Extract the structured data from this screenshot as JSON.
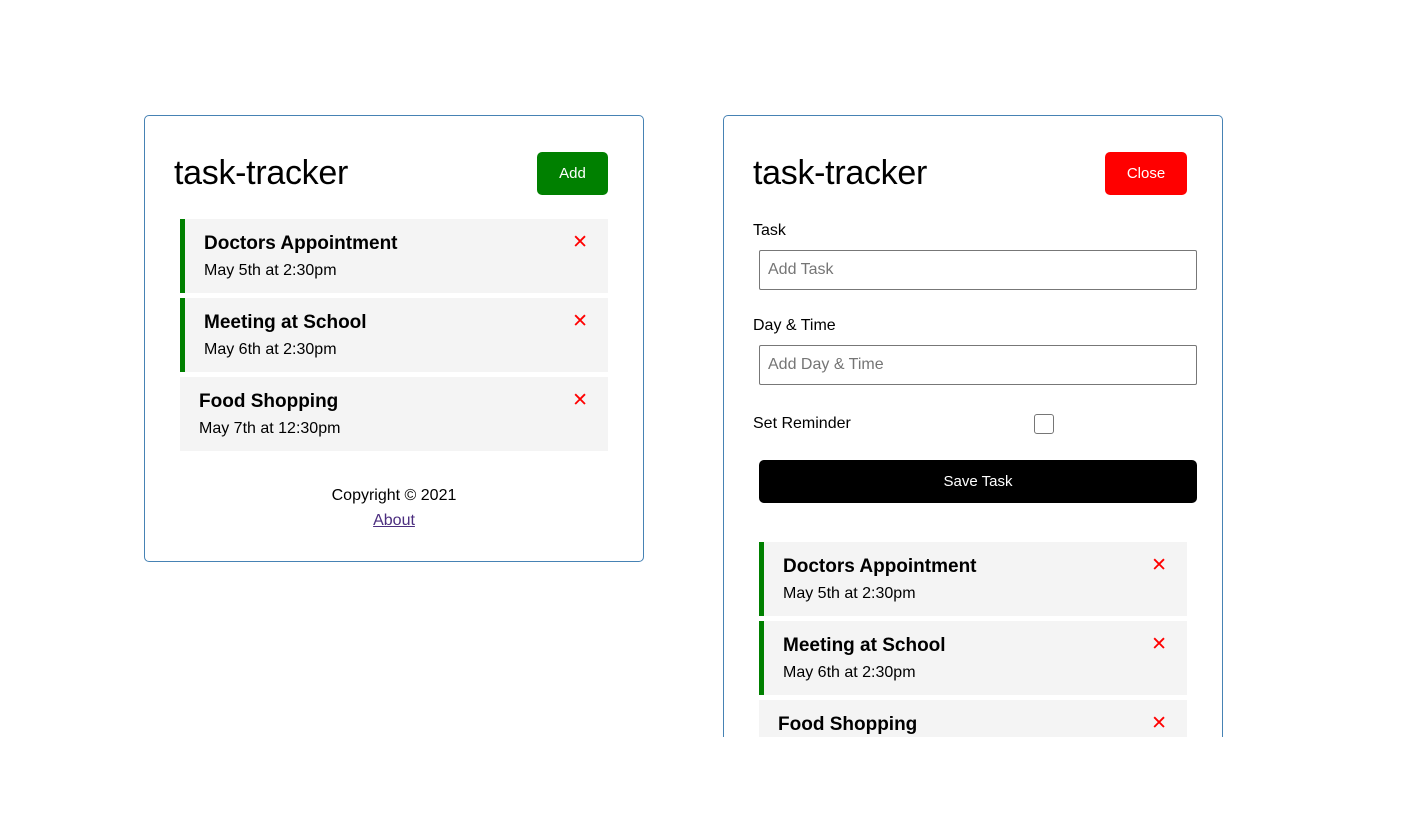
{
  "left_panel": {
    "title": "task-tracker",
    "add_button": "Add",
    "tasks": [
      {
        "text": "Doctors Appointment",
        "day": "May 5th at 2:30pm",
        "reminder": true
      },
      {
        "text": "Meeting at School",
        "day": "May 6th at 2:30pm",
        "reminder": true
      },
      {
        "text": "Food Shopping",
        "day": "May 7th at 12:30pm",
        "reminder": false
      }
    ],
    "footer": {
      "copyright": "Copyright © 2021",
      "about_link": "About"
    }
  },
  "right_panel": {
    "title": "task-tracker",
    "close_button": "Close",
    "form": {
      "task_label": "Task",
      "task_placeholder": "Add Task",
      "day_label": "Day & Time",
      "day_placeholder": "Add Day & Time",
      "reminder_label": "Set Reminder",
      "reminder_checked": false,
      "save_button": "Save Task"
    },
    "tasks": [
      {
        "text": "Doctors Appointment",
        "day": "May 5th at 2:30pm",
        "reminder": true
      },
      {
        "text": "Meeting at School",
        "day": "May 6th at 2:30pm",
        "reminder": true
      },
      {
        "text": "Food Shopping",
        "day": "",
        "reminder": false
      }
    ]
  },
  "icons": {
    "delete": "✕"
  },
  "colors": {
    "border": "#4682b4",
    "add_button": "#008000",
    "close_button": "#ff0000",
    "save_button": "#000000",
    "reminder_bar": "#008000",
    "delete_icon": "#ff0000",
    "task_bg": "#f4f4f4"
  }
}
